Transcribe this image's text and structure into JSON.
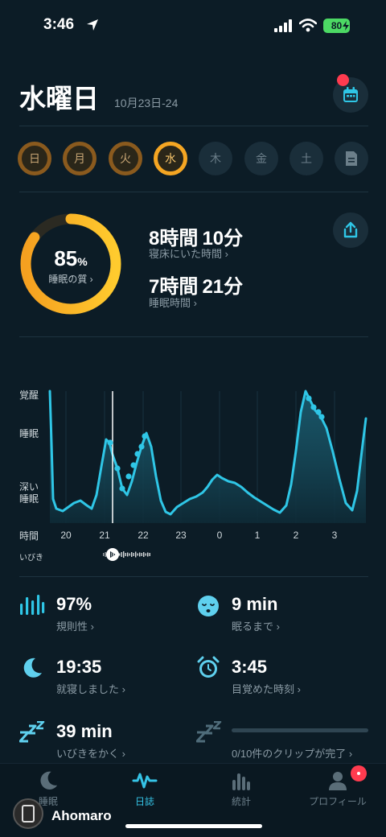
{
  "status_bar": {
    "time": "3:46",
    "battery": "80"
  },
  "header": {
    "day_title": "水曜日",
    "date_range": "10月23日-24"
  },
  "week": {
    "days": [
      {
        "label": "日",
        "state": "past"
      },
      {
        "label": "月",
        "state": "past"
      },
      {
        "label": "火",
        "state": "past"
      },
      {
        "label": "水",
        "state": "current"
      },
      {
        "label": "木",
        "state": "future"
      },
      {
        "label": "金",
        "state": "future"
      },
      {
        "label": "土",
        "state": "future"
      }
    ]
  },
  "summary": {
    "quality_value": "85",
    "quality_unit": "%",
    "quality_label": "睡眠の質 ›",
    "quality_percent": 85,
    "time_in_bed_hours": "8時間",
    "time_in_bed_minutes": "10分",
    "time_in_bed_label": "寝床にいた時間 ›",
    "sleep_time_hours": "7時間",
    "sleep_time_minutes": "21分",
    "sleep_time_label": "睡眠時間 ›"
  },
  "chart_data": {
    "type": "area",
    "y_categories": [
      "覚醒",
      "睡眠",
      "深い睡眠"
    ],
    "x_label": "時間",
    "x_ticks": [
      "20",
      "21",
      "22",
      "23",
      "0",
      "1",
      "2",
      "3"
    ],
    "snore_label": "いびき",
    "colors": {
      "line": "#2fc6e6",
      "marker": "#ffffff"
    }
  },
  "stats": {
    "regularity": {
      "value": "97%",
      "label": "規則性 ›"
    },
    "fall_asleep": {
      "value": "9 min",
      "label": "眠るまで ›"
    },
    "bedtime": {
      "value": "19:35",
      "label": "就寝しました ›"
    },
    "wake_time": {
      "value": "3:45",
      "label": "目覚めた時刻 ›"
    },
    "snoring": {
      "value": "39 min",
      "label": "いびきをかく ›"
    },
    "clips": {
      "label": "0/10件のクリップが完了 ›"
    }
  },
  "tabbar": {
    "tabs": [
      {
        "label": "睡眠"
      },
      {
        "label": "日誌"
      },
      {
        "label": "統計"
      },
      {
        "label": "プロフィール"
      }
    ]
  },
  "watermark": {
    "text": "Ahomaro"
  }
}
